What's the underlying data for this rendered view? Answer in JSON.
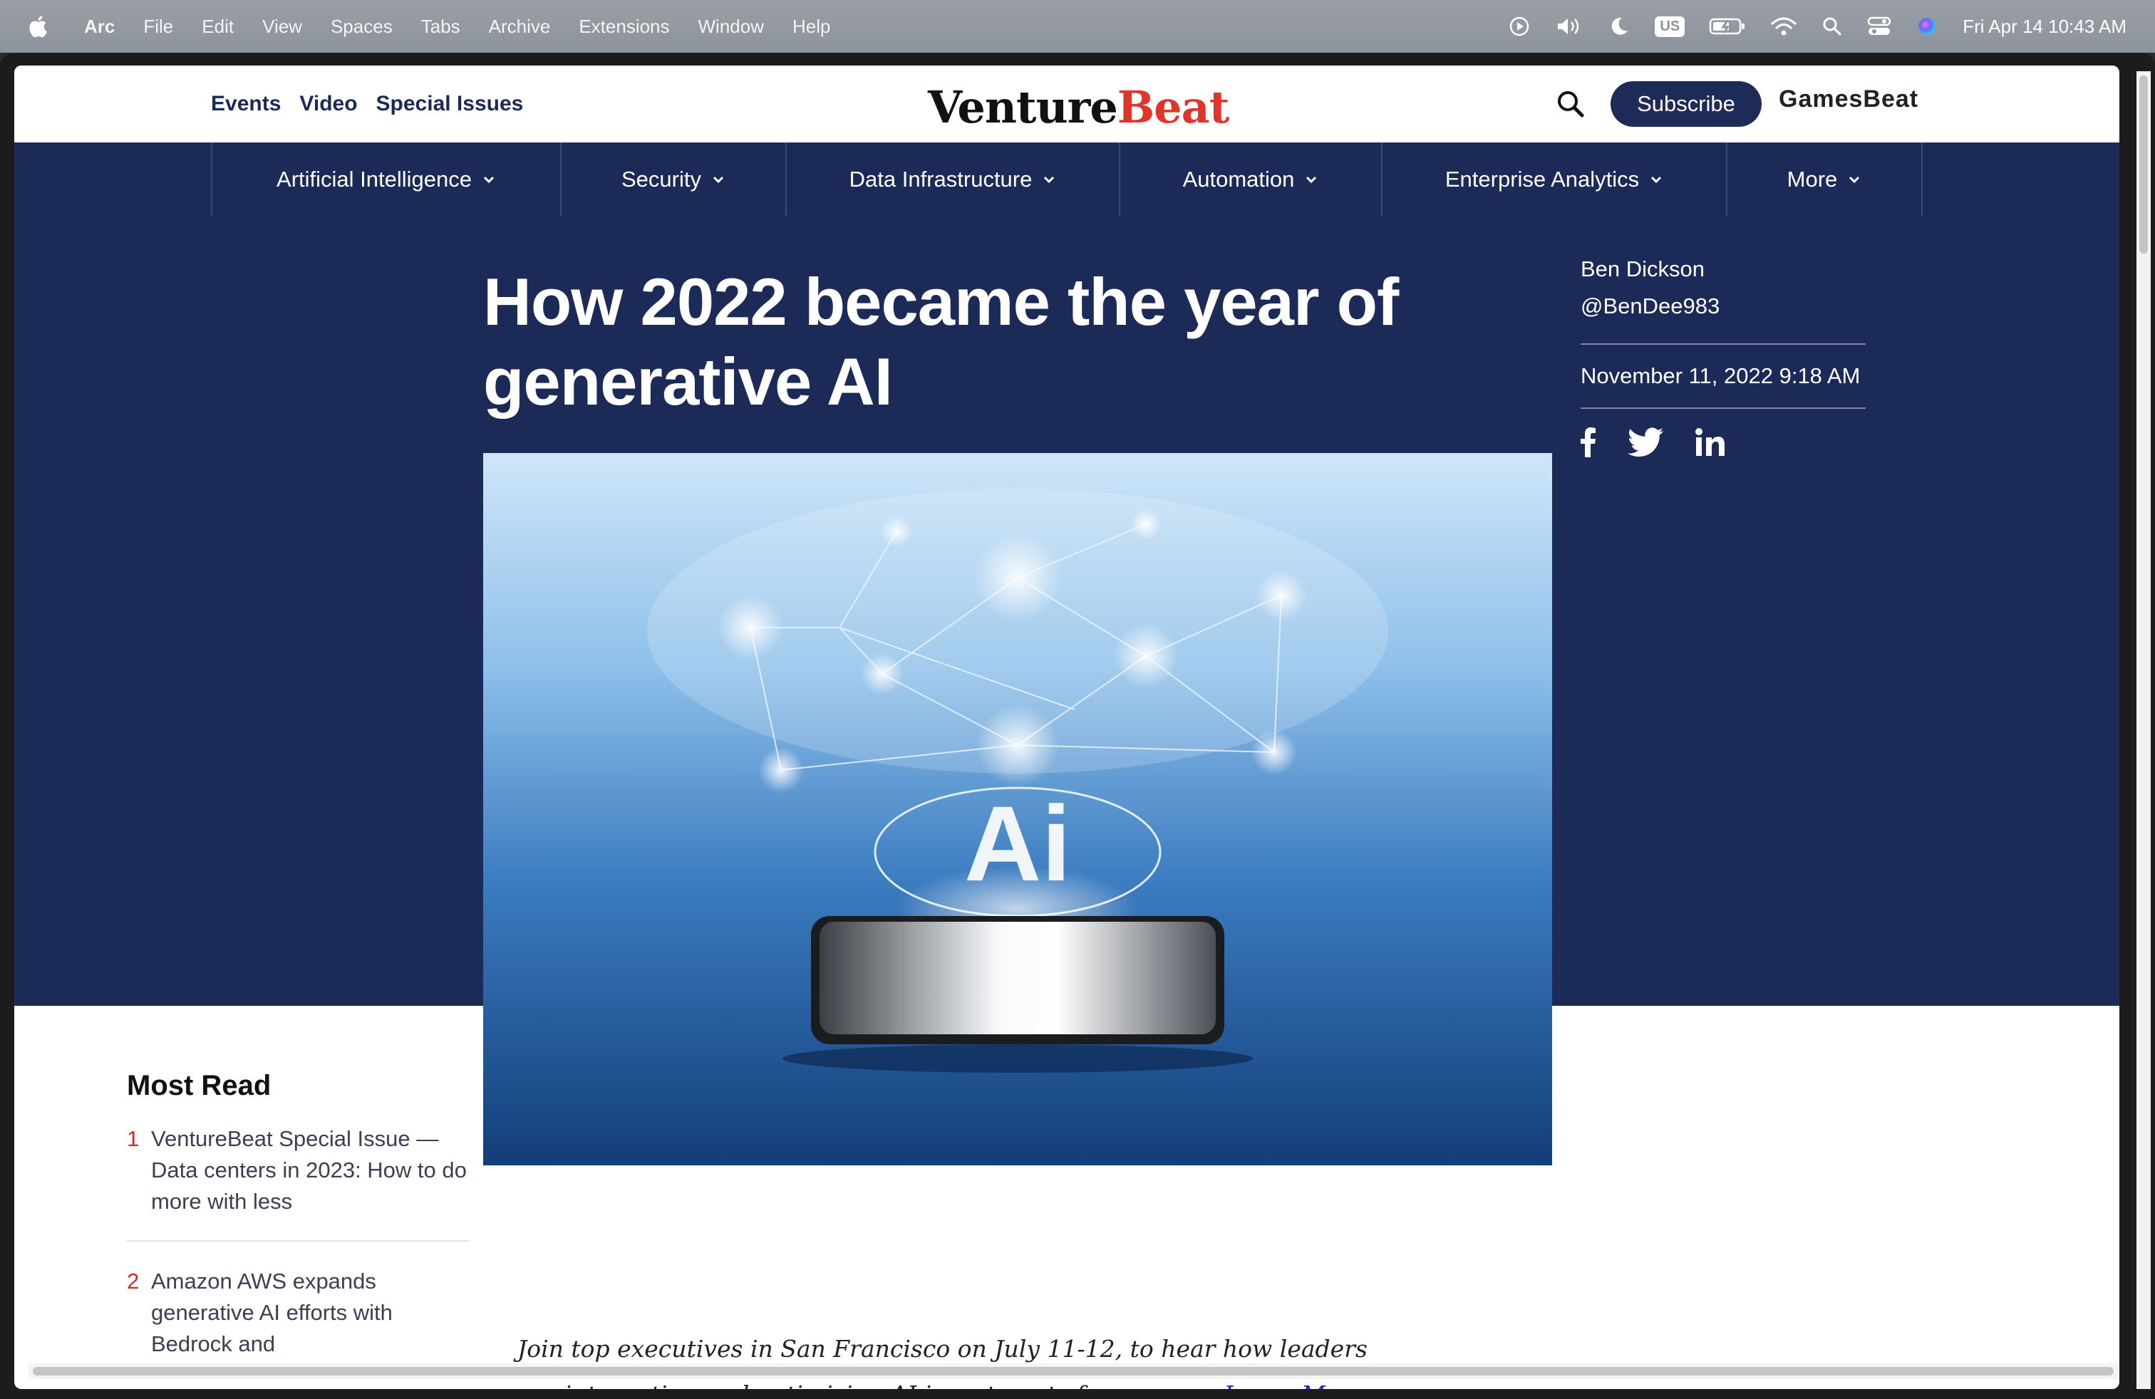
{
  "menubar": {
    "app_name": "Arc",
    "items": [
      "File",
      "Edit",
      "View",
      "Spaces",
      "Tabs",
      "Archive",
      "Extensions",
      "Window",
      "Help"
    ],
    "keyboard_layout": "US",
    "clock": "Fri Apr 14  10:43 AM",
    "icons": [
      "play-icon",
      "volume-icon",
      "moon-icon",
      "keyboard-icon",
      "battery-icon",
      "wifi-icon",
      "spotlight-icon",
      "control-center-icon",
      "siri-icon"
    ]
  },
  "site": {
    "top_links": [
      "Events",
      "Video",
      "Special Issues"
    ],
    "logo_part1": "Venture",
    "logo_part2": "Beat",
    "subscribe_label": "Subscribe",
    "gamesbeat_label": "GamesBeat",
    "colors": {
      "navy": "#1c2a57",
      "brand_red": "#e0352b"
    }
  },
  "nav": {
    "categories": [
      {
        "label": "Artificial Intelligence"
      },
      {
        "label": "Security"
      },
      {
        "label": "Data Infrastructure"
      },
      {
        "label": "Automation"
      },
      {
        "label": "Enterprise Analytics"
      },
      {
        "label": "More"
      }
    ]
  },
  "article": {
    "headline": "How 2022 became the year of generative AI",
    "author": "Ben Dickson",
    "handle": "@BenDee983",
    "date": "November 11, 2022 9:18 AM",
    "social": [
      "facebook-icon",
      "twitter-icon",
      "linkedin-icon"
    ],
    "promo_text": "Join top executives in San Francisco on July 11-12, to hear how leaders are integrating and optimizing AI investments for success.",
    "promo_link": "Learn More"
  },
  "most_read": {
    "title": "Most Read",
    "items": [
      {
        "num": "1",
        "text": "VentureBeat Special Issue — Data centers in 2023: How to do more with less"
      },
      {
        "num": "2",
        "text": "Amazon AWS expands generative AI efforts with Bedrock and"
      }
    ]
  }
}
